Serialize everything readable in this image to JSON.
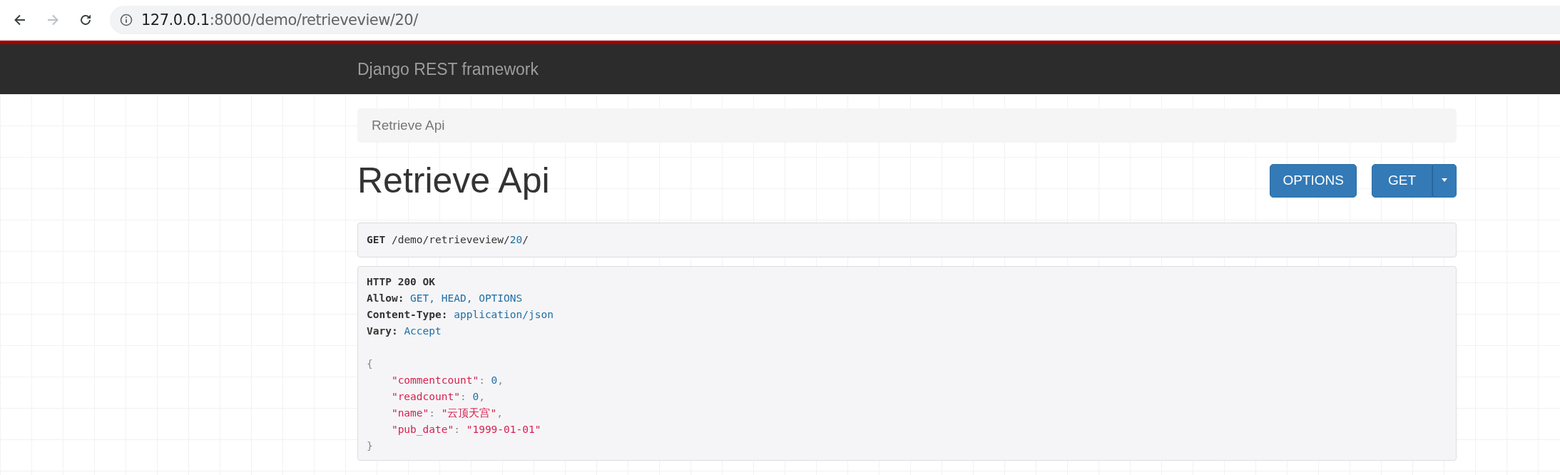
{
  "browser": {
    "nav": [
      {
        "kind": "back",
        "disabled": false
      },
      {
        "kind": "forward",
        "disabled": true
      },
      {
        "kind": "reload",
        "disabled": false
      }
    ],
    "url_host": "127.0.0.1",
    "url_rest": ":8000/demo/retrieveview/20/"
  },
  "navbar": {
    "brand": "Django REST framework"
  },
  "breadcrumb": [
    "Retrieve Api"
  ],
  "title": "Retrieve Api",
  "buttons": [
    {
      "kind": "plain",
      "label": "OPTIONS"
    },
    {
      "kind": "split",
      "label": "GET"
    }
  ],
  "request": [
    {
      "kind": "bold",
      "text": "GET"
    },
    {
      "kind": "plain",
      "text": " /demo/retrieveview/"
    },
    {
      "kind": "link",
      "text": "20"
    },
    {
      "kind": "plain",
      "text": "/"
    }
  ],
  "response_headers": [
    [
      {
        "kind": "bold",
        "text": "HTTP 200 OK"
      }
    ],
    [
      {
        "kind": "bold",
        "text": "Allow:"
      },
      {
        "kind": "link",
        "text": " GET, HEAD, OPTIONS"
      }
    ],
    [
      {
        "kind": "bold",
        "text": "Content-Type:"
      },
      {
        "kind": "link",
        "text": " application/json"
      }
    ],
    [
      {
        "kind": "bold",
        "text": "Vary:"
      },
      {
        "kind": "link",
        "text": " Accept"
      }
    ]
  ],
  "response_body": [
    {
      "kind": "brace",
      "tokens": [
        {
          "kind": "punct",
          "text": "{"
        }
      ]
    },
    {
      "kind": "field",
      "tokens": [
        {
          "kind": "key",
          "text": "\"commentcount\""
        },
        {
          "kind": "punct",
          "text": ": "
        },
        {
          "kind": "number",
          "text": "0"
        },
        {
          "kind": "punct",
          "text": ","
        }
      ]
    },
    {
      "kind": "field",
      "tokens": [
        {
          "kind": "key",
          "text": "\"readcount\""
        },
        {
          "kind": "punct",
          "text": ": "
        },
        {
          "kind": "number",
          "text": "0"
        },
        {
          "kind": "punct",
          "text": ","
        }
      ]
    },
    {
      "kind": "field",
      "tokens": [
        {
          "kind": "key",
          "text": "\"name\""
        },
        {
          "kind": "punct",
          "text": ": "
        },
        {
          "kind": "string",
          "text": "\"云顶天宫\""
        },
        {
          "kind": "punct",
          "text": ","
        }
      ]
    },
    {
      "kind": "field",
      "tokens": [
        {
          "kind": "key",
          "text": "\"pub_date\""
        },
        {
          "kind": "punct",
          "text": ": "
        },
        {
          "kind": "string",
          "text": "\"1999-01-01\""
        }
      ]
    },
    {
      "kind": "brace",
      "tokens": [
        {
          "kind": "punct",
          "text": "}"
        }
      ]
    }
  ]
}
